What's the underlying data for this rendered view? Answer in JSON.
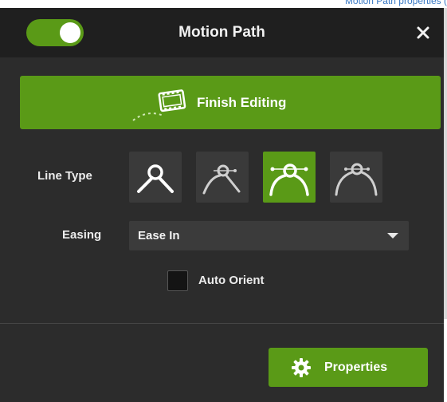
{
  "top_strip": {
    "text": "Motion Path properties ("
  },
  "header": {
    "toggle": {
      "state": "on",
      "color": "#5a9a17"
    },
    "title": "Motion Path",
    "close_icon": "close-icon"
  },
  "finish_button": {
    "label": "Finish Editing",
    "icon": "filmstrip-path-icon"
  },
  "line_type": {
    "label": "Line Type",
    "options": [
      {
        "icon": "line-type-angle-icon",
        "selected": false
      },
      {
        "icon": "line-type-angle-handles-icon",
        "selected": false
      },
      {
        "icon": "line-type-curve-handles-icon",
        "selected": true
      },
      {
        "icon": "line-type-curve-icon",
        "selected": false
      }
    ]
  },
  "easing": {
    "label": "Easing",
    "value": "Ease In"
  },
  "auto_orient": {
    "label": "Auto Orient",
    "checked": false
  },
  "properties_button": {
    "label": "Properties",
    "icon": "gear-icon"
  },
  "colors": {
    "accent": "#5a9a17",
    "panel": "#2c2c2c",
    "header": "#1f1f1f"
  }
}
